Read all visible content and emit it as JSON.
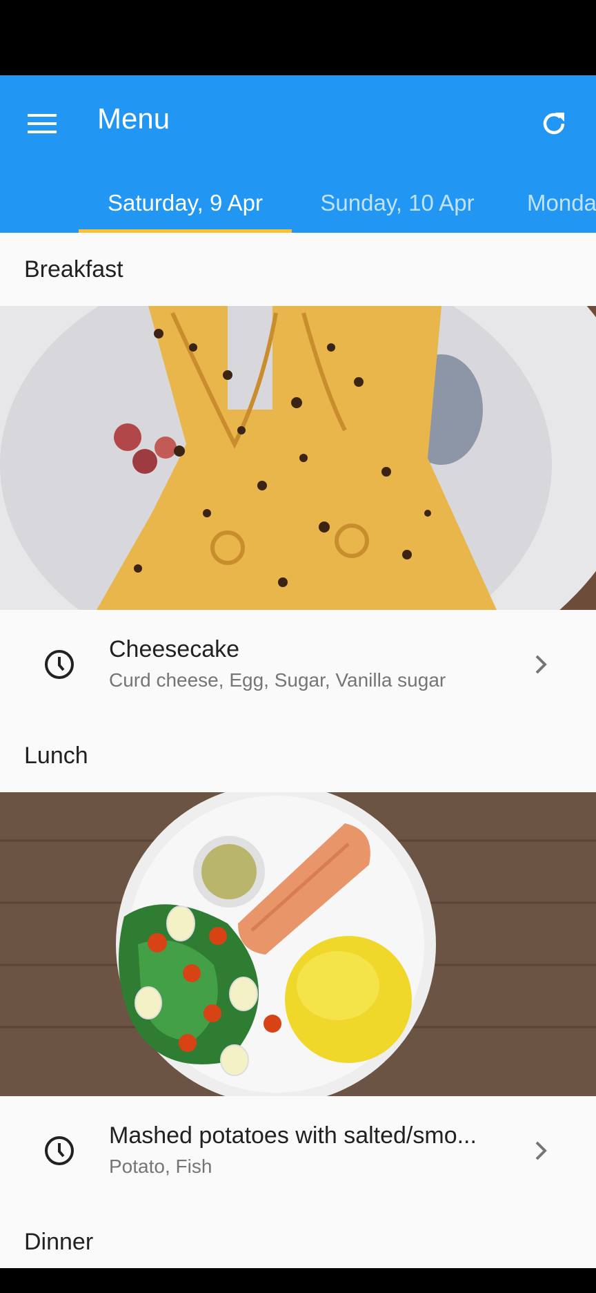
{
  "appbar": {
    "title": "Menu",
    "menu_icon": "hamburger-menu-icon",
    "refresh_icon": "refresh-icon",
    "color": "#2196f3"
  },
  "tabs": [
    {
      "label": "Saturday, 9 Apr",
      "selected": true
    },
    {
      "label": "Sunday, 10 Apr",
      "selected": false
    },
    {
      "label": "Monda",
      "selected": false
    }
  ],
  "indicator_color": "#fbc02d",
  "sections": {
    "breakfast": {
      "title": "Breakfast",
      "item": {
        "name": "Cheesecake",
        "ingredients": "Curd cheese, Egg, Sugar, Vanilla sugar",
        "icon": "clock-icon",
        "chevron": "chevron-right-icon"
      }
    },
    "lunch": {
      "title": "Lunch",
      "item": {
        "name": "Mashed potatoes with salted/smo...",
        "ingredients": "Potato, Fish",
        "icon": "clock-icon",
        "chevron": "chevron-right-icon"
      }
    },
    "dinner": {
      "title": "Dinner"
    }
  }
}
